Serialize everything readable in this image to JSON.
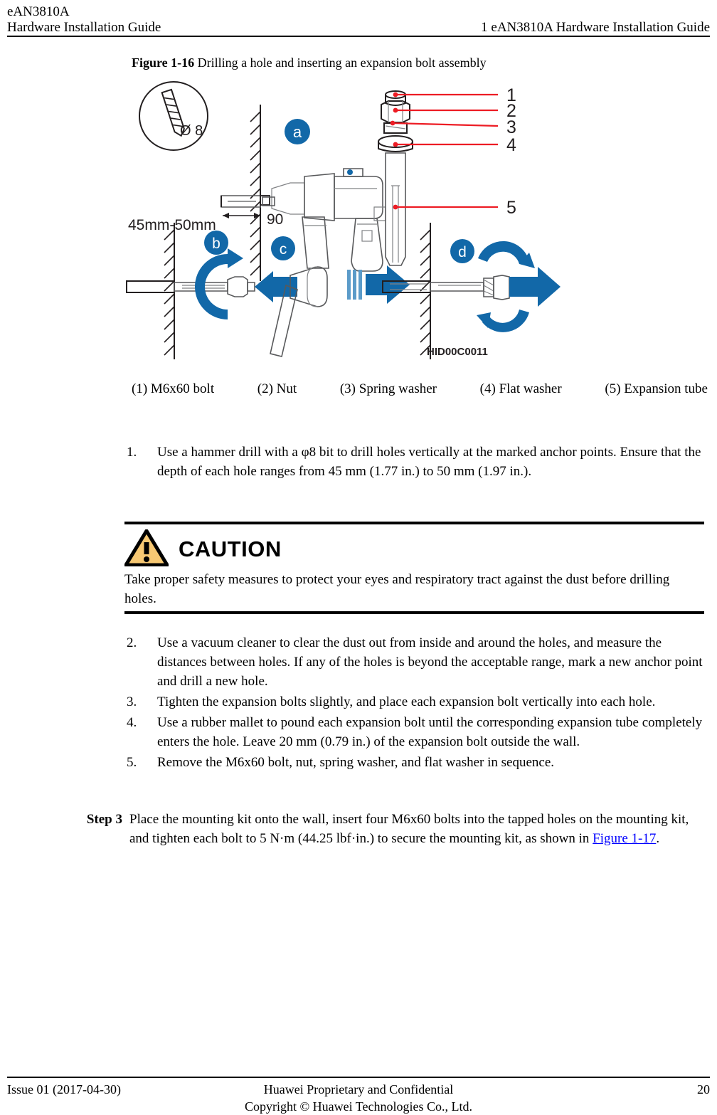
{
  "header": {
    "left_line1": "eAN3810A",
    "left_line2": "Hardware Installation Guide",
    "right": "1 eAN3810A Hardware Installation Guide"
  },
  "figure": {
    "number": "Figure 1-16",
    "title": "Drilling a hole and inserting an expansion bolt assembly",
    "drawing_id": "HID00C0011",
    "annotations": {
      "bit_diameter": "Ø 8",
      "hole_depth": "45mm-50mm",
      "drill_angle": "90",
      "step_a": "a",
      "step_b": "b",
      "step_c": "c",
      "step_d": "d",
      "callouts": [
        "1",
        "2",
        "3",
        "4",
        "5"
      ]
    },
    "legend": [
      "(1) M6x60 bolt",
      "(2) Nut",
      "(3) Spring washer",
      "(4) Flat washer",
      "(5) Expansion tube"
    ]
  },
  "steps_part1": [
    {
      "marker": "1.",
      "text": "Use a hammer drill with a φ8 bit to drill holes vertically at the marked anchor points. Ensure that the depth of each hole ranges from 45 mm (1.77 in.) to 50 mm (1.97 in.)."
    }
  ],
  "caution": {
    "icon": "warning-triangle-icon",
    "title": "CAUTION",
    "body": "Take proper safety measures to protect your eyes and respiratory tract against the dust before drilling holes.",
    "icon_fill": "#F7C873",
    "icon_stroke": "#000000"
  },
  "steps_part2": [
    {
      "marker": "2.",
      "text": "Use a vacuum cleaner to clear the dust out from inside and around the holes, and measure the distances between holes. If any of the holes is beyond the acceptable range, mark a new anchor point and drill a new hole."
    },
    {
      "marker": "3.",
      "text": "Tighten the expansion bolts slightly, and place each expansion bolt vertically into each hole."
    },
    {
      "marker": "4.",
      "text": "Use a rubber mallet to pound each expansion bolt until the corresponding expansion tube completely enters the hole. Leave 20 mm (0.79 in.) of the expansion bolt outside the wall."
    },
    {
      "marker": "5.",
      "text": "Remove the M6x60 bolt, nut, spring washer, and flat washer in sequence."
    }
  ],
  "step3": {
    "label": "Step 3",
    "text_before": "Place the mounting kit onto the wall, insert four M6x60 bolts into the tapped holes on the mounting kit, and tighten each bolt to 5 N·m (44.25 lbf·in.) to secure the mounting kit, as shown in ",
    "link": "Figure 1-17",
    "text_after": "."
  },
  "footer": {
    "issue": "Issue 01 (2017-04-30)",
    "confidential_line1": "Huawei Proprietary and Confidential",
    "confidential_line2": "Copyright © Huawei Technologies Co., Ltd.",
    "page_number": "20"
  },
  "colors": {
    "accent_blue": "#1268A8",
    "link_blue": "#0000FF",
    "callout_red": "#ED1C24",
    "line_gray": "#58595B"
  }
}
